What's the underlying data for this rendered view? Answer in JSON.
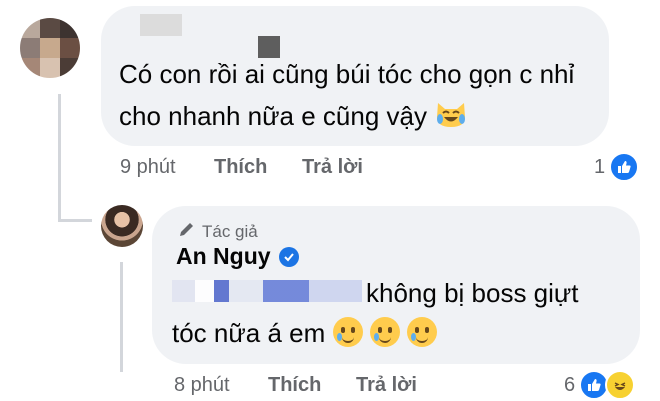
{
  "comment": {
    "text_line1": "Có con rồi ai cũng búi tóc cho gọn c nhỉ",
    "text_line2": "cho nhanh nữa e cũng vậy",
    "emoji_name": "crying-laughing-cat-icon",
    "time": "9 phút",
    "like_label": "Thích",
    "reply_label": "Trả lời",
    "reaction_count": "1"
  },
  "reply": {
    "author_tag": "Tác giả",
    "author_name": "An Nguy",
    "text_line1": "không bị boss giựt",
    "text_line2": "tóc nữa á em",
    "time": "8 phút",
    "like_label": "Thích",
    "reply_label": "Trả lời",
    "reaction_count": "6"
  },
  "colors": {
    "bubble": "#f0f2f5",
    "meta_text": "#65676b",
    "like_blue": "#1877f2",
    "thread_line": "#d3d6db"
  }
}
